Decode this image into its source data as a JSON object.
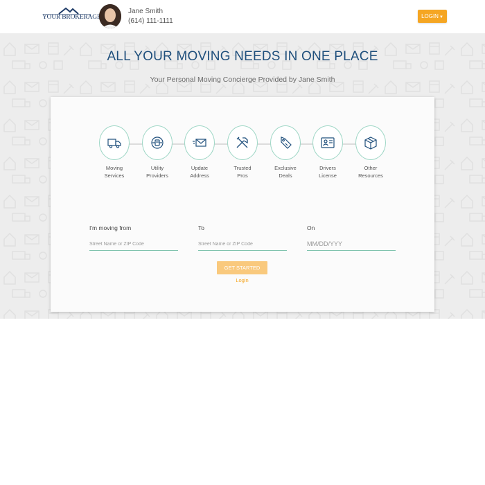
{
  "header": {
    "brand": "YOUR BROKERAGE",
    "agent_name": "Jane Smith",
    "agent_phone": "(614) 111-1111",
    "login_label": "LOGIN"
  },
  "hero": {
    "title": "ALL YOUR MOVING NEEDS IN ONE PLACE",
    "subtitle": "Your Personal Moving Concierge Provided by Jane Smith"
  },
  "steps": [
    {
      "line1": "Moving",
      "line2": "Services",
      "icon": "truck-icon"
    },
    {
      "line1": "Utility",
      "line2": "Providers",
      "icon": "plug-icon"
    },
    {
      "line1": "Update",
      "line2": "Address",
      "icon": "envelope-icon"
    },
    {
      "line1": "Trusted",
      "line2": "Pros",
      "icon": "tools-icon"
    },
    {
      "line1": "Exclusive",
      "line2": "Deals",
      "icon": "price-tag-icon"
    },
    {
      "line1": "Drivers",
      "line2": "License",
      "icon": "id-card-icon"
    },
    {
      "line1": "Other",
      "line2": "Resources",
      "icon": "box-icon"
    }
  ],
  "form": {
    "from_label": "I'm moving from",
    "from_placeholder": "Street Name or ZIP Code",
    "to_label": "To",
    "to_placeholder": "Street Name or ZIP Code",
    "date_label": "On",
    "date_placeholder": "MM/DD/YYY",
    "submit_label": "GET STARTED",
    "login_link": "Login"
  },
  "colors": {
    "brand_navy": "#1f4f7c",
    "accent_orange": "#f5a623",
    "step_border": "#9fd7c6"
  }
}
